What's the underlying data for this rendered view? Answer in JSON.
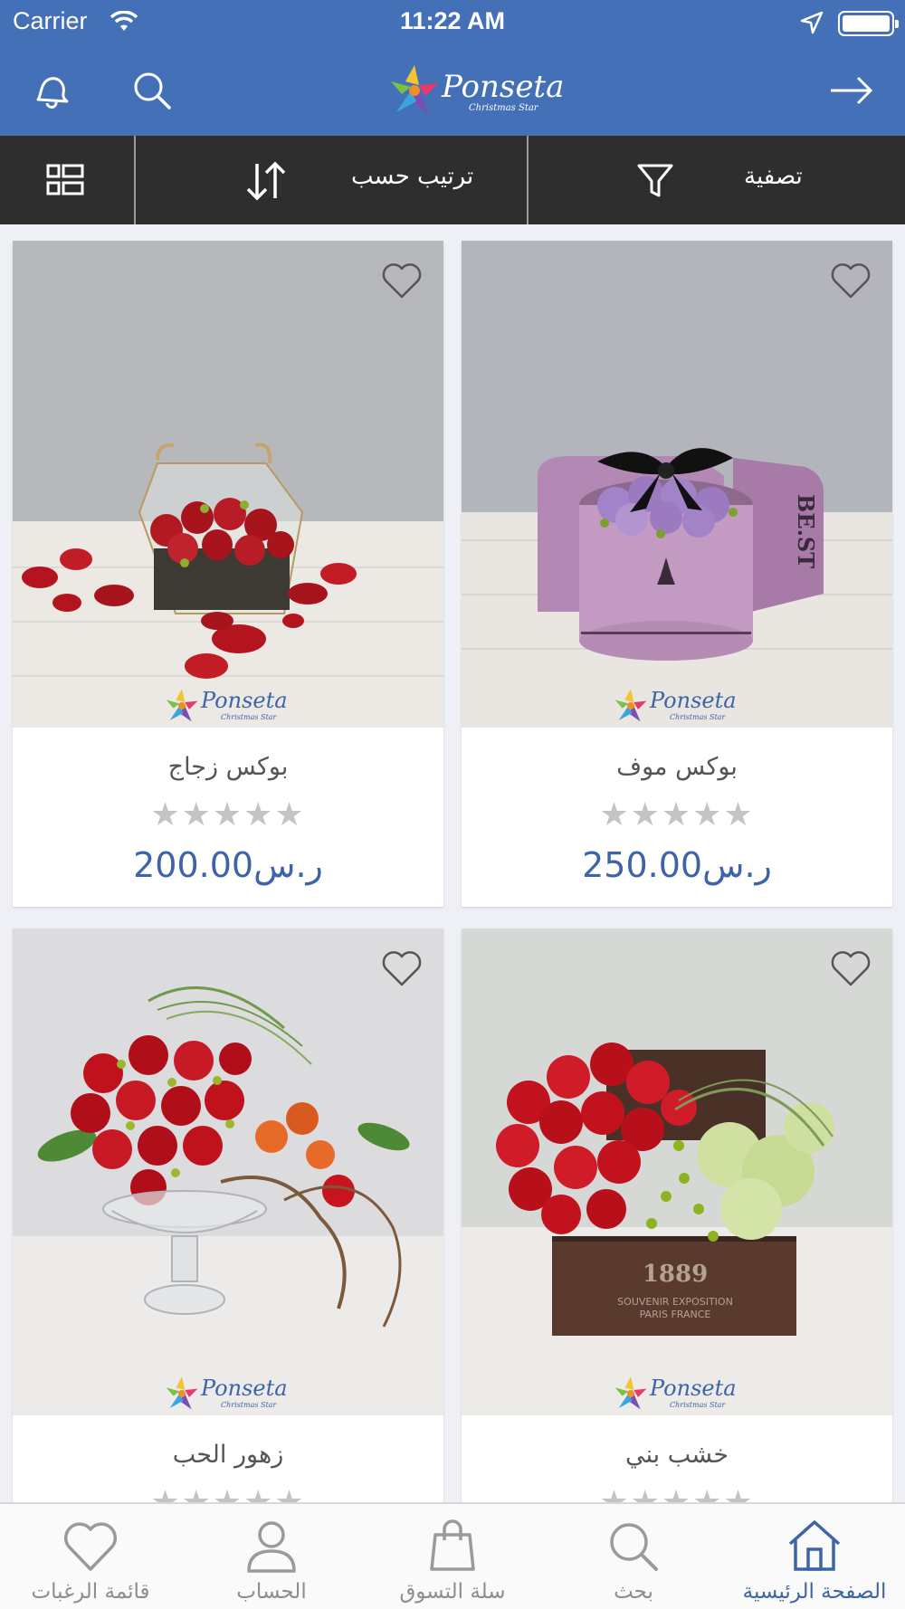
{
  "status_bar": {
    "carrier": "Carrier",
    "time": "11:22 AM"
  },
  "header": {
    "logo_text": "Ponseta",
    "logo_tagline": "Christmas Star",
    "icons": [
      "bell-icon",
      "search-icon",
      "arrow-right-icon"
    ]
  },
  "toolbar": {
    "filter_label": "تصفية",
    "sort_label": "ترتيب حسب",
    "icons": [
      "filter-icon",
      "sort-icon",
      "grid-view-icon"
    ]
  },
  "products": [
    {
      "name": "بوكس موف",
      "price": "ر.س250.00",
      "rating": 0,
      "stars": "★★★★★"
    },
    {
      "name": "بوكس زجاج",
      "price": "ر.س200.00",
      "rating": 0,
      "stars": "★★★★★"
    },
    {
      "name": "خشب بني",
      "price": "",
      "rating": 0,
      "stars": "★★★★★"
    },
    {
      "name": "زهور الحب",
      "price": "",
      "rating": 0,
      "stars": "★★★★★"
    }
  ],
  "watermark": {
    "text": "Ponseta",
    "tagline": "Christmas Star"
  },
  "tabs": [
    {
      "label": "الصفحة الرئيسية",
      "icon": "home-icon",
      "active": true
    },
    {
      "label": "بحث",
      "icon": "search-icon",
      "active": false
    },
    {
      "label": "سلة التسوق",
      "icon": "shopping-bag-icon",
      "active": false
    },
    {
      "label": "الحساب",
      "icon": "user-icon",
      "active": false
    },
    {
      "label": "قائمة الرغبات",
      "icon": "heart-icon",
      "active": false
    }
  ],
  "colors": {
    "brand_blue": "#4470b8",
    "toolbar_dark": "#2e2e2e",
    "price_blue": "#3e64a8",
    "star_gray": "#c4c4c4"
  }
}
